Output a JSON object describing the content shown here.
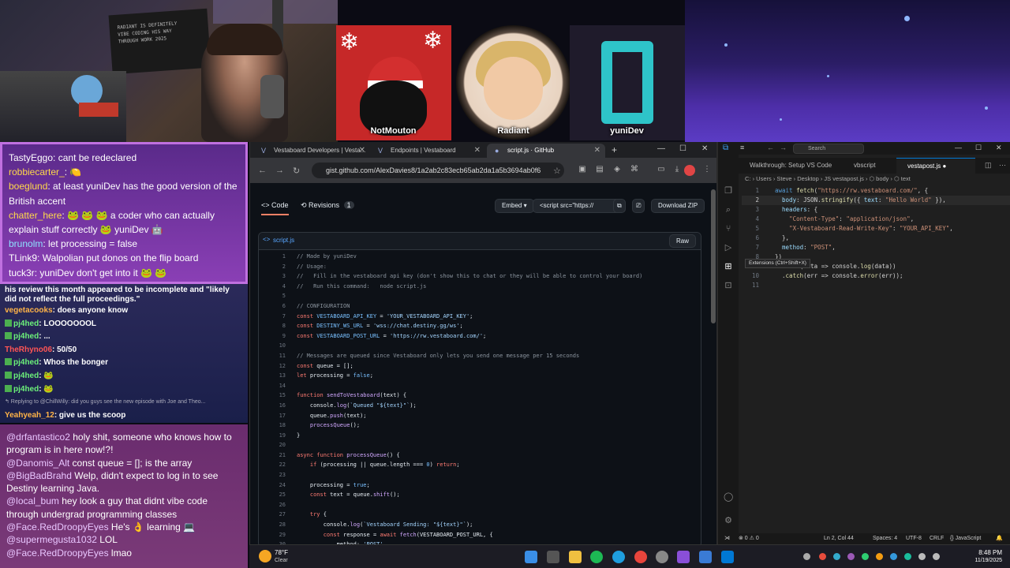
{
  "overlay": {
    "avatars": [
      {
        "name": "NotMouton"
      },
      {
        "name": "Radiant"
      },
      {
        "name": "yuniDev"
      }
    ],
    "poster_text": "RADIANT IS DEFINITELY\nVIBE CODING HIS WAY\nTHROUGH WORK 2025"
  },
  "chat_top": [
    {
      "user": "TastyEggo",
      "text": ": cant be redeclared"
    },
    {
      "user": "robbiecarter_",
      "text": ": 🍋"
    },
    {
      "user": "boeglund",
      "text": ": at least yuniDev has the good version of the British accent"
    },
    {
      "user": "chatter_here",
      "text": ": 🐸 🐸 🐸 a coder who can actually explain stuff correctly 🐸 yuniDev 🤖"
    },
    {
      "user": "brunolm",
      "text": ": let processing = false"
    },
    {
      "user": "TLink9",
      "text": ": Walpolian put donos on the flip board"
    },
    {
      "user": "tuck3r",
      "text": ": yuniDev don't get into it 🐸 🐸"
    }
  ],
  "chat_mid": {
    "lead": "his review this month appeared to be incomplete and \"likely did not reflect the full proceedings.\"",
    "lines": [
      {
        "user": "vegetacooks",
        "text": ": does anyone know",
        "color": "org",
        "badge": false
      },
      {
        "user": "pj4hed",
        "text": ": LOOOOOOOL",
        "color": "grn",
        "badge": true
      },
      {
        "user": "pj4hed",
        "text": ": ...",
        "color": "grn",
        "badge": true
      },
      {
        "user": "TheRhyno06",
        "text": ": 50/50",
        "color": "red",
        "badge": false
      },
      {
        "user": "pj4hed",
        "text": ": Whos the bonger",
        "color": "grn",
        "badge": true
      },
      {
        "user": "pj4hed",
        "text": ": 🐸",
        "color": "grn",
        "badge": true
      },
      {
        "user": "pj4hed",
        "text": ": 🐸",
        "color": "grn",
        "badge": true
      }
    ],
    "reply": "↰ Replying to @ChillWilly: did you guys see the new episode with Joe and Theo...",
    "last_user": "Yeahyeah_12",
    "last_text": ": give us the scoop"
  },
  "chat_bot": [
    {
      "user": "@drfantastico2",
      "text": " holy shit, someone who knows how to program is in here now!?!"
    },
    {
      "user": "@Danomis_Alt",
      "text": " const queue = []; is the array"
    },
    {
      "user": "@BigBadBrahd",
      "text": " Welp, didn't expect to log in to see Destiny learning Java."
    },
    {
      "user": "@local_bum",
      "text": " hey look a guy that didnt vibe code through undergrad programming classes"
    },
    {
      "user": "@Face.RedDroopyEyes",
      "text": " He's 👌 learning 💻"
    },
    {
      "user": "@supermegusta1032",
      "text": " LOL"
    },
    {
      "user": "@Face.RedDroopyEyes",
      "text": " lmao"
    }
  ],
  "browser": {
    "tabs": [
      {
        "label": "Vestaboard Developers | Vesta..."
      },
      {
        "label": "Endpoints | Vestaboard"
      },
      {
        "label": "script.js · GitHub"
      }
    ],
    "url": "gist.github.com/AlexDavies8/1a2ab2c83ecb65ab2da1a5b3694ab0f6",
    "code_tab": "Code",
    "revisions_tab": "Revisions",
    "revisions_count": "1",
    "embed_label": "Embed ▾",
    "embed_value": "<script src=\"https://",
    "download_label": "Download ZIP",
    "file_name": "script.js",
    "raw_label": "Raw"
  },
  "code_lines": [
    [
      {
        "c": "cm",
        "t": "// Made by yuniDev"
      }
    ],
    [
      {
        "c": "cm",
        "t": "// Usage:"
      }
    ],
    [
      {
        "c": "cm",
        "t": "//   Fill in the vestaboard api key (don't show this to chat or they will be able to control your board)"
      }
    ],
    [
      {
        "c": "cm",
        "t": "//   Run this command:   node script.js"
      }
    ],
    [],
    [
      {
        "c": "cm",
        "t": "// CONFIGURATION"
      }
    ],
    [
      {
        "c": "kw",
        "t": "const "
      },
      {
        "c": "nm",
        "t": "VESTABOARD_API_KEY"
      },
      {
        "c": "",
        "t": " = "
      },
      {
        "c": "st",
        "t": "'YOUR_VESTABOARD_API_KEY'"
      },
      {
        "c": "",
        "t": ";"
      }
    ],
    [
      {
        "c": "kw",
        "t": "const "
      },
      {
        "c": "nm",
        "t": "DESTINY_WS_URL"
      },
      {
        "c": "",
        "t": " = "
      },
      {
        "c": "st",
        "t": "'wss://chat.destiny.gg/ws'"
      },
      {
        "c": "",
        "t": ";"
      }
    ],
    [
      {
        "c": "kw",
        "t": "const "
      },
      {
        "c": "nm",
        "t": "VESTABOARD_POST_URL"
      },
      {
        "c": "",
        "t": " = "
      },
      {
        "c": "st",
        "t": "'https://rw.vestaboard.com/'"
      },
      {
        "c": "",
        "t": ";"
      }
    ],
    [],
    [
      {
        "c": "cm",
        "t": "// Messages are queued since Vestaboard only lets you send one message per 15 seconds"
      }
    ],
    [
      {
        "c": "kw",
        "t": "const "
      },
      {
        "c": "",
        "t": "queue = [];"
      }
    ],
    [
      {
        "c": "kw",
        "t": "let "
      },
      {
        "c": "",
        "t": "processing = "
      },
      {
        "c": "nm",
        "t": "false"
      },
      {
        "c": "",
        "t": ";"
      }
    ],
    [],
    [
      {
        "c": "kw",
        "t": "function "
      },
      {
        "c": "fn",
        "t": "sendToVestaboard"
      },
      {
        "c": "",
        "t": "(text) {"
      }
    ],
    [
      {
        "c": "",
        "t": "    console."
      },
      {
        "c": "fn",
        "t": "log"
      },
      {
        "c": "",
        "t": "("
      },
      {
        "c": "st",
        "t": "`Queued \"${text}\"`"
      },
      {
        "c": "",
        "t": ");"
      }
    ],
    [
      {
        "c": "",
        "t": "    queue."
      },
      {
        "c": "fn",
        "t": "push"
      },
      {
        "c": "",
        "t": "(text);"
      }
    ],
    [
      {
        "c": "",
        "t": "    "
      },
      {
        "c": "fn",
        "t": "processQueue"
      },
      {
        "c": "",
        "t": "();"
      }
    ],
    [
      {
        "c": "",
        "t": "}"
      }
    ],
    [],
    [
      {
        "c": "kw",
        "t": "async function "
      },
      {
        "c": "fn",
        "t": "processQueue"
      },
      {
        "c": "",
        "t": "() {"
      }
    ],
    [
      {
        "c": "",
        "t": "    "
      },
      {
        "c": "kw",
        "t": "if "
      },
      {
        "c": "",
        "t": "(processing || queue.length === "
      },
      {
        "c": "nm",
        "t": "0"
      },
      {
        "c": "",
        "t": ") "
      },
      {
        "c": "kw",
        "t": "return"
      },
      {
        "c": "",
        "t": ";"
      }
    ],
    [],
    [
      {
        "c": "",
        "t": "    processing = "
      },
      {
        "c": "nm",
        "t": "true"
      },
      {
        "c": "",
        "t": ";"
      }
    ],
    [
      {
        "c": "",
        "t": "    "
      },
      {
        "c": "kw",
        "t": "const "
      },
      {
        "c": "",
        "t": "text = queue."
      },
      {
        "c": "fn",
        "t": "shift"
      },
      {
        "c": "",
        "t": "();"
      }
    ],
    [],
    [
      {
        "c": "",
        "t": "    "
      },
      {
        "c": "kw",
        "t": "try "
      },
      {
        "c": "",
        "t": "{"
      }
    ],
    [
      {
        "c": "",
        "t": "        console."
      },
      {
        "c": "fn",
        "t": "log"
      },
      {
        "c": "",
        "t": "("
      },
      {
        "c": "st",
        "t": "`Vestaboard Sending: \"${text}\"`"
      },
      {
        "c": "",
        "t": ");"
      }
    ],
    [
      {
        "c": "",
        "t": "        "
      },
      {
        "c": "kw",
        "t": "const "
      },
      {
        "c": "",
        "t": "response = "
      },
      {
        "c": "kw",
        "t": "await "
      },
      {
        "c": "fn",
        "t": "fetch"
      },
      {
        "c": "",
        "t": "(VESTABOARD_POST_URL, {"
      }
    ],
    [
      {
        "c": "",
        "t": "            method: "
      },
      {
        "c": "st",
        "t": "'POST'"
      },
      {
        "c": "",
        "t": ","
      }
    ]
  ],
  "vscode": {
    "search": "Search",
    "tabs": [
      {
        "label": "Walkthrough: Setup VS Code"
      },
      {
        "label": "vbscript"
      },
      {
        "label": "vestapost.js"
      }
    ],
    "breadcrumb": "C: › Users › Steve › Desktop › JS vestapost.js › ⬡ body › ⬡ text",
    "tooltip": "Extensions (Ctrl+Shift+X)",
    "lines": [
      [
        {
          "c": "vk",
          "t": "await "
        },
        {
          "c": "vf",
          "t": "fetch"
        },
        {
          "c": "",
          "t": "("
        },
        {
          "c": "vs",
          "t": "\"https://rw.vestaboard.com/\""
        },
        {
          "c": "",
          "t": ", {"
        }
      ],
      [
        {
          "c": "",
          "t": "  "
        },
        {
          "c": "vp",
          "t": "body"
        },
        {
          "c": "",
          "t": ": JSON."
        },
        {
          "c": "vf",
          "t": "stringify"
        },
        {
          "c": "",
          "t": "({ "
        },
        {
          "c": "vp",
          "t": "text"
        },
        {
          "c": "",
          "t": ": "
        },
        {
          "c": "vs",
          "t": "\"Hello World\""
        },
        {
          "c": "",
          "t": " }),"
        }
      ],
      [
        {
          "c": "",
          "t": "  "
        },
        {
          "c": "vp",
          "t": "headers"
        },
        {
          "c": "",
          "t": ": {"
        }
      ],
      [
        {
          "c": "",
          "t": "    "
        },
        {
          "c": "vs",
          "t": "\"Content-Type\""
        },
        {
          "c": "",
          "t": ": "
        },
        {
          "c": "vs",
          "t": "\"application/json\""
        },
        {
          "c": "",
          "t": ","
        }
      ],
      [
        {
          "c": "",
          "t": "    "
        },
        {
          "c": "vs",
          "t": "\"X-Vestaboard-Read-Write-Key\""
        },
        {
          "c": "",
          "t": ": "
        },
        {
          "c": "vs",
          "t": "\"YOUR_API_KEY\""
        },
        {
          "c": "",
          "t": ","
        }
      ],
      [
        {
          "c": "",
          "t": "  },"
        }
      ],
      [
        {
          "c": "",
          "t": "  "
        },
        {
          "c": "vp",
          "t": "method"
        },
        {
          "c": "",
          "t": ": "
        },
        {
          "c": "vs",
          "t": "\"POST\""
        },
        {
          "c": "",
          "t": ","
        }
      ],
      [
        {
          "c": "",
          "t": "})"
        }
      ],
      [
        {
          "c": "",
          "t": "  ."
        },
        {
          "c": "vf",
          "t": "then"
        },
        {
          "c": "",
          "t": "(data => console."
        },
        {
          "c": "vf",
          "t": "log"
        },
        {
          "c": "",
          "t": "(data))"
        }
      ],
      [
        {
          "c": "",
          "t": "  ."
        },
        {
          "c": "vf",
          "t": "catch"
        },
        {
          "c": "",
          "t": "(err => console."
        },
        {
          "c": "vf",
          "t": "error"
        },
        {
          "c": "",
          "t": "(err));"
        }
      ],
      []
    ],
    "status": {
      "errors": "⊗ 0 ⚠ 0",
      "position": "Ln 2, Col 44",
      "spaces": "Spaces: 4",
      "encoding": "UTF-8",
      "eol": "CRLF",
      "language": "{} JavaScript"
    }
  },
  "taskbar": {
    "temp": "78°F",
    "condition": "Clear",
    "time": "8:48 PM",
    "date": "11/19/2025"
  }
}
